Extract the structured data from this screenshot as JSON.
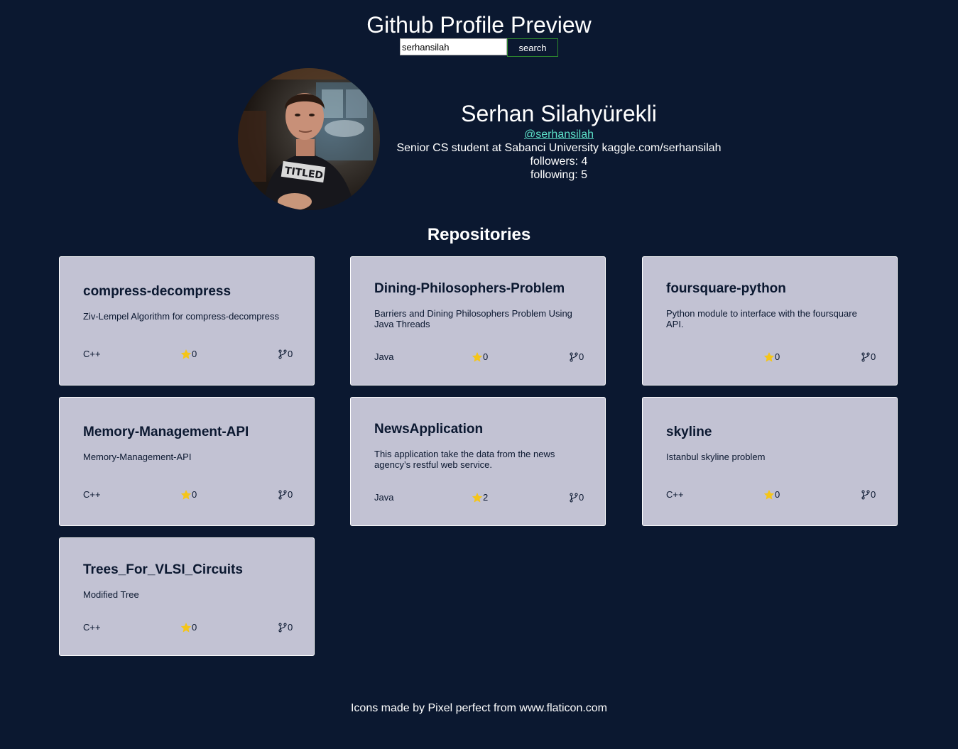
{
  "header": {
    "title": "Github Profile Preview",
    "search_value": "serhansilah",
    "search_button": "search"
  },
  "profile": {
    "avatar_alt": "profile photo",
    "name": "Serhan Silahyürekli",
    "handle": "@serhansilah",
    "bio": "Senior CS student at Sabanci University kaggle.com/serhansilah",
    "followers": "followers: 4",
    "following": "following: 5"
  },
  "repositories": {
    "title": "Repositories",
    "items": [
      {
        "name": "compress-decompress",
        "description": "Ziv-Lempel Algorithm for compress-decompress",
        "language": "C++",
        "stars": "0",
        "forks": "0"
      },
      {
        "name": "Dining-Philosophers-Problem",
        "description": "Barriers and Dining Philosophers Problem Using Java Threads",
        "language": "Java",
        "stars": "0",
        "forks": "0"
      },
      {
        "name": "foursquare-python",
        "description": "Python module to interface with the foursquare API.",
        "language": "",
        "stars": "0",
        "forks": "0"
      },
      {
        "name": "Memory-Management-API",
        "description": "Memory-Management-API",
        "language": "C++",
        "stars": "0",
        "forks": "0"
      },
      {
        "name": "NewsApplication",
        "description": "This application take the data from the news agency’s restful web service.",
        "language": "Java",
        "stars": "2",
        "forks": "0"
      },
      {
        "name": "skyline",
        "description": "Istanbul skyline problem",
        "language": "C++",
        "stars": "0",
        "forks": "0"
      },
      {
        "name": "Trees_For_VLSI_Circuits",
        "description": "Modified Tree",
        "language": "C++",
        "stars": "0",
        "forks": "0"
      }
    ]
  },
  "icons": {
    "star": "star-icon",
    "fork": "fork-icon",
    "star_color": "#f5c518",
    "fork_color": "#0b1830"
  },
  "colors": {
    "background": "#0b1830",
    "card": "#c2c2d3",
    "link": "#5ce0c8",
    "button_border": "#2e8b2e"
  },
  "footer": {
    "text": "Icons made by Pixel perfect from www.flaticon.com"
  }
}
